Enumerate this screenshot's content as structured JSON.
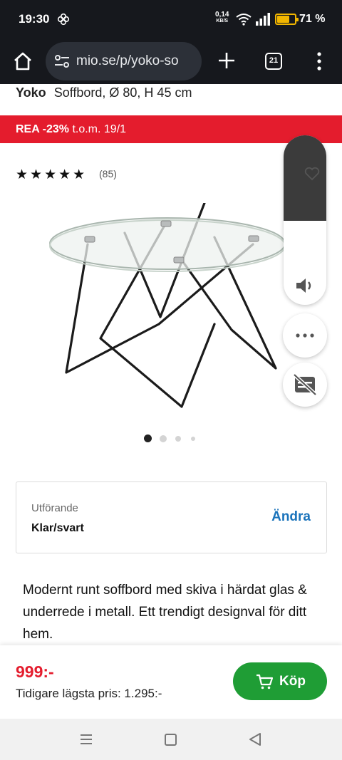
{
  "status_bar": {
    "time": "19:30",
    "net_speed": "0,14",
    "net_unit": "KB/S",
    "battery_percent": "71 %",
    "battery_level": 0.71,
    "icons": [
      "pinwheel-icon",
      "wifi-icon",
      "signal-icon",
      "battery-icon"
    ]
  },
  "browser": {
    "url": "mio.se/p/yoko-so",
    "tab_count": "21",
    "icons": [
      "home-icon",
      "site-settings-icon",
      "new-tab-plus-icon",
      "tab-switcher-icon",
      "menu-dots-icon"
    ]
  },
  "product": {
    "brand": "Yoko",
    "subtitle": "Soffbord, Ø 80, H 45 cm",
    "sale_label": "REA -23%",
    "sale_period": "t.o.m. 19/1",
    "stars": "★★★★★",
    "rating_value": 5,
    "review_count": "(85)",
    "image_count": 4,
    "active_image_index": 0
  },
  "variant": {
    "label": "Utförande",
    "value": "Klar/svart",
    "change_label": "Ändra"
  },
  "description": "Modernt runt soffbord med skiva i härdat glas & underrede i metall. Ett trendigt designval för ditt hem.",
  "buy_bar": {
    "price": "999:-",
    "previous_price": "Tidigare lägsta pris: 1.295:-",
    "buy_label": "Köp"
  },
  "colors": {
    "sale_red": "#e41c2d",
    "buy_green": "#1f9d35",
    "link_blue": "#1a73bb",
    "browser_dark": "#16181d"
  }
}
